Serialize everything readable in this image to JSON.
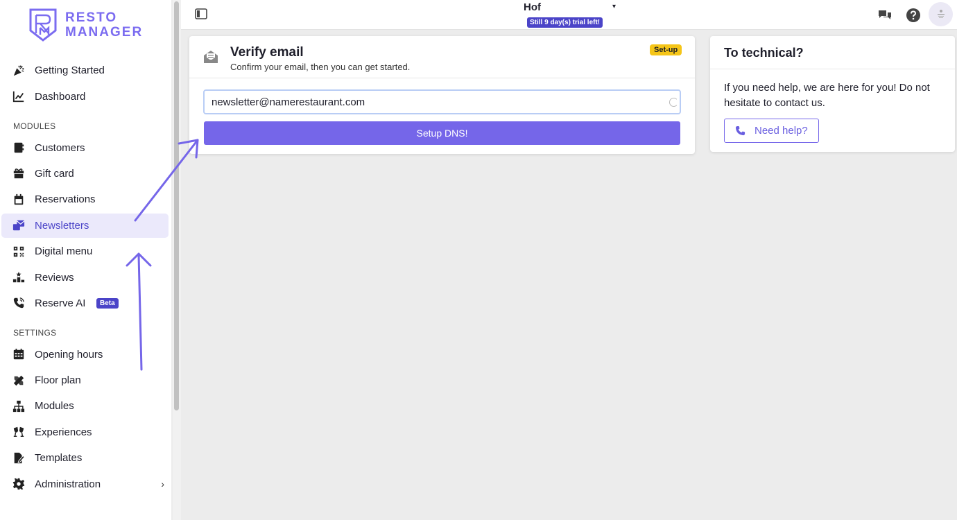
{
  "brand": {
    "line1": "RESTO",
    "line2": "MANAGER",
    "accent": "#7b6cf0"
  },
  "sidebar": {
    "items_top": [
      {
        "label": "Getting Started",
        "icon": "party-popper-icon"
      },
      {
        "label": "Dashboard",
        "icon": "line-chart-icon"
      }
    ],
    "modules_heading": "MODULES",
    "modules": [
      {
        "label": "Customers",
        "icon": "address-book-icon"
      },
      {
        "label": "Gift card",
        "icon": "gift-icon"
      },
      {
        "label": "Reservations",
        "icon": "calendar-icon"
      },
      {
        "label": "Newsletters",
        "icon": "newsletter-icon",
        "active": true
      },
      {
        "label": "Digital menu",
        "icon": "qr-code-icon"
      },
      {
        "label": "Reviews",
        "icon": "podium-star-icon"
      },
      {
        "label": "Reserve AI",
        "icon": "phone-ai-icon",
        "badge": "Beta"
      }
    ],
    "settings_heading": "SETTINGS",
    "settings": [
      {
        "label": "Opening hours",
        "icon": "calendar-grid-icon"
      },
      {
        "label": "Floor plan",
        "icon": "pencil-ruler-icon"
      },
      {
        "label": "Modules",
        "icon": "sitemap-icon"
      },
      {
        "label": "Experiences",
        "icon": "glasses-cheers-icon"
      },
      {
        "label": "Templates",
        "icon": "file-signature-icon"
      },
      {
        "label": "Administration",
        "icon": "gear-icon",
        "chevron": "›"
      }
    ]
  },
  "topbar": {
    "venue": "Hof",
    "venue_caret": "▾",
    "trial": "Still 9 day(s) trial left!"
  },
  "verify_card": {
    "title": "Verify email",
    "subtitle": "Confirm your email, then you can get started.",
    "badge": "Set-up",
    "email_value": "newsletter@namerestaurant.com",
    "button_label": "Setup DNS!"
  },
  "tech_card": {
    "title": "To technical?",
    "body": "If you need help, we are here for you! Do not hesitate to contact us.",
    "button_label": "Need help?"
  }
}
